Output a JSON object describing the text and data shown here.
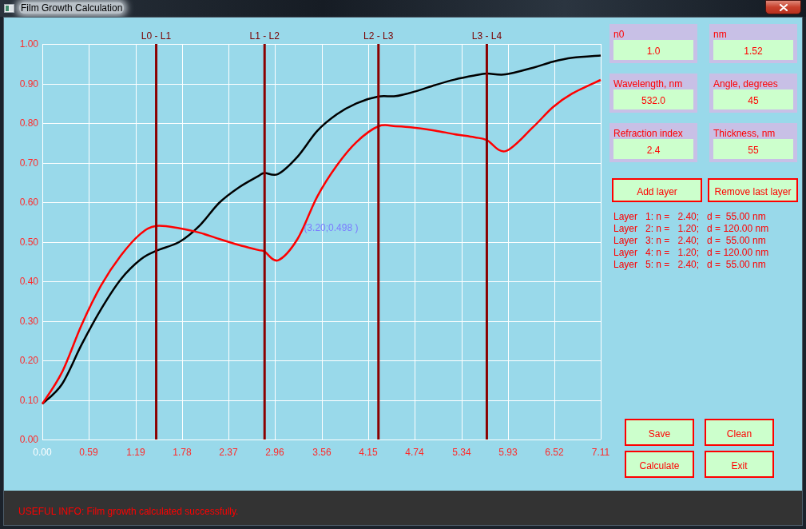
{
  "window": {
    "title": "Film Growth Calculation"
  },
  "chart": {
    "chart_data": {
      "type": "line",
      "xlim": [
        0,
        7.11
      ],
      "ylim": [
        0,
        1
      ],
      "grid": true,
      "xticks": [
        {
          "value": 0,
          "label": "0.00"
        },
        {
          "value": 0.59,
          "label": "0.59"
        },
        {
          "value": 1.19,
          "label": "1.19"
        },
        {
          "value": 1.78,
          "label": "1.78"
        },
        {
          "value": 2.37,
          "label": "2.37"
        },
        {
          "value": 2.96,
          "label": "2.96"
        },
        {
          "value": 3.56,
          "label": "3.56"
        },
        {
          "value": 4.15,
          "label": "4.15"
        },
        {
          "value": 4.74,
          "label": "4.74"
        },
        {
          "value": 5.34,
          "label": "5.34"
        },
        {
          "value": 5.93,
          "label": "5.93"
        },
        {
          "value": 6.52,
          "label": "6.52"
        },
        {
          "value": 7.11,
          "label": "7.11"
        }
      ],
      "yticks": [
        {
          "value": 0,
          "label": "0.00"
        },
        {
          "value": 0.1,
          "label": "0.10"
        },
        {
          "value": 0.2,
          "label": "0.20"
        },
        {
          "value": 0.3,
          "label": "0.30"
        },
        {
          "value": 0.4,
          "label": "0.40"
        },
        {
          "value": 0.5,
          "label": "0.50"
        },
        {
          "value": 0.6,
          "label": "0.60"
        },
        {
          "value": 0.7,
          "label": "0.70"
        },
        {
          "value": 0.8,
          "label": "0.80"
        },
        {
          "value": 0.9,
          "label": "0.90"
        },
        {
          "value": 1,
          "label": "1.00"
        }
      ],
      "x": [
        0,
        0.25,
        0.5,
        0.75,
        1.0,
        1.25,
        1.45,
        1.75,
        2.0,
        2.25,
        2.5,
        2.75,
        2.83,
        3.0,
        3.25,
        3.5,
        3.75,
        4.0,
        4.28,
        4.5,
        4.75,
        5.0,
        5.25,
        5.5,
        5.66,
        5.9,
        6.25,
        6.5,
        6.75,
        7.11
      ],
      "series": [
        {
          "color": "#000000",
          "values": [
            0.09,
            0.14,
            0.24,
            0.33,
            0.405,
            0.455,
            0.477,
            0.5,
            0.54,
            0.598,
            0.637,
            0.666,
            0.674,
            0.671,
            0.715,
            0.78,
            0.822,
            0.85,
            0.867,
            0.868,
            0.88,
            0.896,
            0.91,
            0.92,
            0.925,
            0.923,
            0.94,
            0.955,
            0.965,
            0.971
          ]
        },
        {
          "color": "#ff0000",
          "values": [
            0.09,
            0.17,
            0.29,
            0.39,
            0.465,
            0.52,
            0.54,
            0.534,
            0.523,
            0.507,
            0.492,
            0.479,
            0.475,
            0.453,
            0.507,
            0.614,
            0.693,
            0.752,
            0.792,
            0.792,
            0.788,
            0.781,
            0.772,
            0.764,
            0.757,
            0.729,
            0.79,
            0.84,
            0.875,
            0.909
          ]
        }
      ],
      "ref_lines": [
        {
          "axis": "x",
          "value": 1.45,
          "label": "L0 - L1"
        },
        {
          "axis": "x",
          "value": 2.83,
          "label": "L1 - L2"
        },
        {
          "axis": "x",
          "value": 4.28,
          "label": "L2 - L3"
        },
        {
          "axis": "x",
          "value": 5.66,
          "label": "L3 - L4"
        }
      ],
      "annotations": [
        {
          "text": "(3.20;0.498 )",
          "x": 3.33,
          "y": 0.535
        }
      ]
    }
  },
  "parameters": [
    {
      "label": "n0",
      "value": "1.0"
    },
    {
      "label": "nm",
      "value": "1.52"
    },
    {
      "label": "Wavelength, nm",
      "value": "532.0"
    },
    {
      "label": "Angle, degrees",
      "value": "45"
    },
    {
      "label": "Refraction index",
      "value": "2.4"
    },
    {
      "label": "Thickness, nm",
      "value": "55"
    }
  ],
  "layer_buttons": [
    "Add layer",
    "Remove last layer"
  ],
  "layers": [
    "Layer   1: n =   2.40;   d =  55.00 nm",
    "Layer   2: n =   1.20;   d = 120.00 nm",
    "Layer   3: n =   2.40;   d =  55.00 nm",
    "Layer   4: n =   1.20;   d = 120.00 nm",
    "Layer   5: n =   2.40;   d =  55.00 nm"
  ],
  "action_buttons": [
    "Save",
    "Clean",
    "Calculate",
    "Exit"
  ],
  "status_bar": {
    "text": "USEFUL INFO: Film growth calculated successfully."
  }
}
